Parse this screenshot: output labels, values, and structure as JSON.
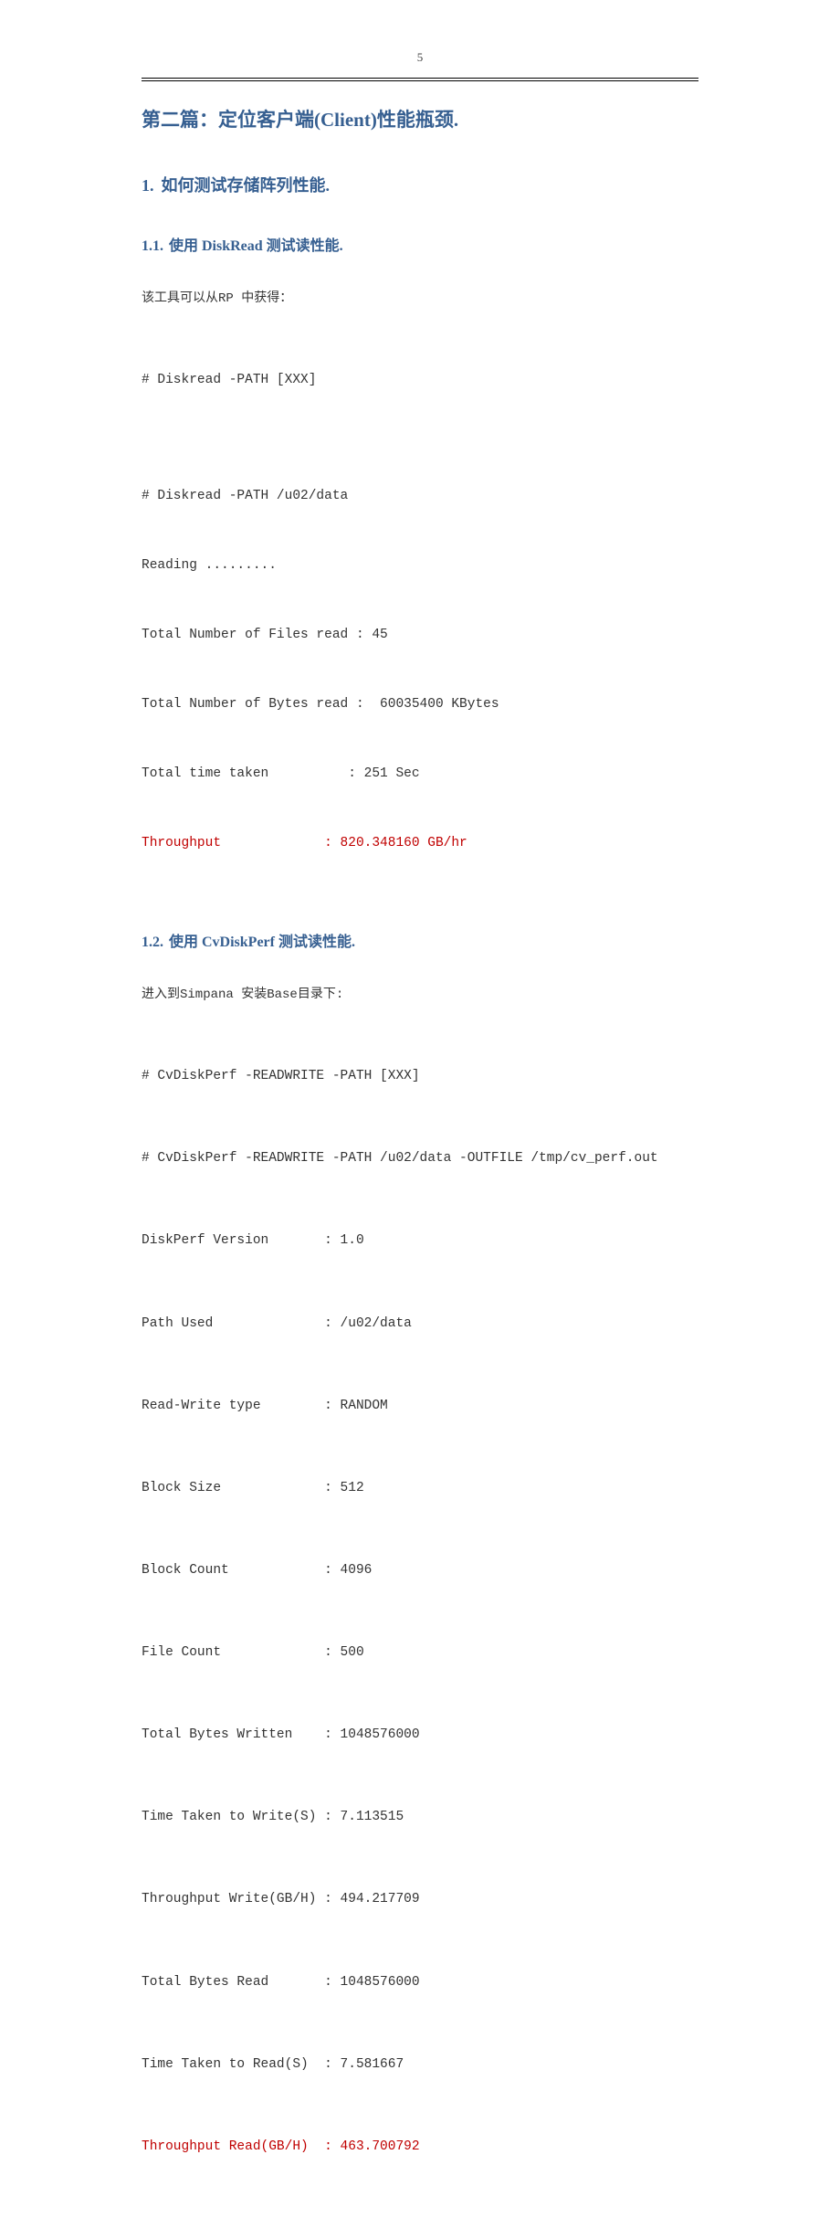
{
  "page_number": "5",
  "h1": "第二篇：定位客户端(Client)性能瓶颈.",
  "h2": {
    "num": "1.",
    "text": "如何测试存储阵列性能."
  },
  "s11": {
    "num": "1.1.",
    "title": "使用 DiskRead  测试读性能.",
    "intro": "该工具可以从RP 中获得：",
    "lines": [
      "# Diskread -PATH [XXX]",
      "",
      "# Diskread -PATH /u02/data",
      "Reading .........",
      "Total Number of Files read : 45",
      "Total Number of Bytes read :  60035400 KBytes",
      "Total time taken          : 251 Sec"
    ],
    "red_line": "Throughput             : 820.348160 GB/hr"
  },
  "s12": {
    "num": "1.2.",
    "title": "使用 CvDiskPerf  测试读性能.",
    "intro": "进入到Simpana 安装Base目录下:",
    "lines": [
      "# CvDiskPerf -READWRITE -PATH [XXX]",
      "# CvDiskPerf -READWRITE -PATH /u02/data -OUTFILE /tmp/cv_perf.out",
      "DiskPerf Version       : 1.0",
      "Path Used              : /u02/data",
      "Read-Write type        : RANDOM",
      "Block Size             : 512",
      "Block Count            : 4096",
      "File Count             : 500",
      "Total Bytes Written    : 1048576000",
      "Time Taken to Write(S) : 7.113515",
      "Throughput Write(GB/H) : 494.217709",
      "Total Bytes Read       : 1048576000",
      "Time Taken to Read(S)  : 7.581667"
    ],
    "red_line": "Throughput Read(GB/H)  : 463.700792"
  }
}
